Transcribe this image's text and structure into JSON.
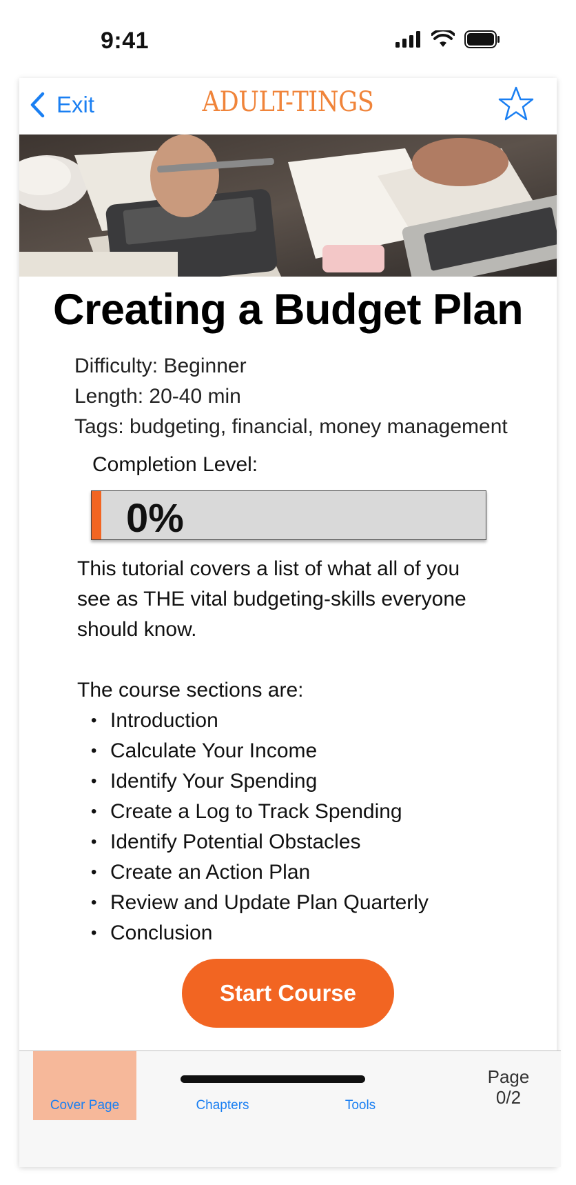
{
  "status_bar": {
    "time": "9:41"
  },
  "nav": {
    "back_label": "Exit",
    "app_title": "ADULT-TINGS"
  },
  "course": {
    "title": "Creating a Budget Plan",
    "difficulty": "Difficulty: Beginner",
    "length": "Length: 20-40 min",
    "tags": "Tags: budgeting, financial, money management",
    "completion_label": "Completion Level:",
    "completion_text": "0%",
    "completion_fraction": 0.0,
    "description": "This tutorial covers a list of what all of you see as THE vital budgeting-skills everyone should know.",
    "sections_heading": "The course sections are:",
    "sections": [
      "Introduction",
      "Calculate Your Income",
      "Identify Your Spending",
      "Create a Log to Track Spending",
      "Identify Potential Obstacles",
      "Create an Action Plan",
      "Review and Update Plan Quarterly",
      "Conclusion"
    ],
    "start_button": "Start Course"
  },
  "tabs": [
    {
      "label": "Cover Page",
      "active": true
    },
    {
      "label": "Chapters",
      "active": false
    },
    {
      "label": "Tools",
      "active": false
    }
  ],
  "page_indicator": {
    "label": "Page",
    "value": "0/2"
  },
  "colors": {
    "accent": "#f26522",
    "link": "#1a7ff2",
    "title": "#f0843a",
    "active_tab": "#f6b89a"
  },
  "icons": [
    "chevron-left-icon",
    "star-icon",
    "signal-icon",
    "wifi-icon",
    "battery-icon"
  ]
}
